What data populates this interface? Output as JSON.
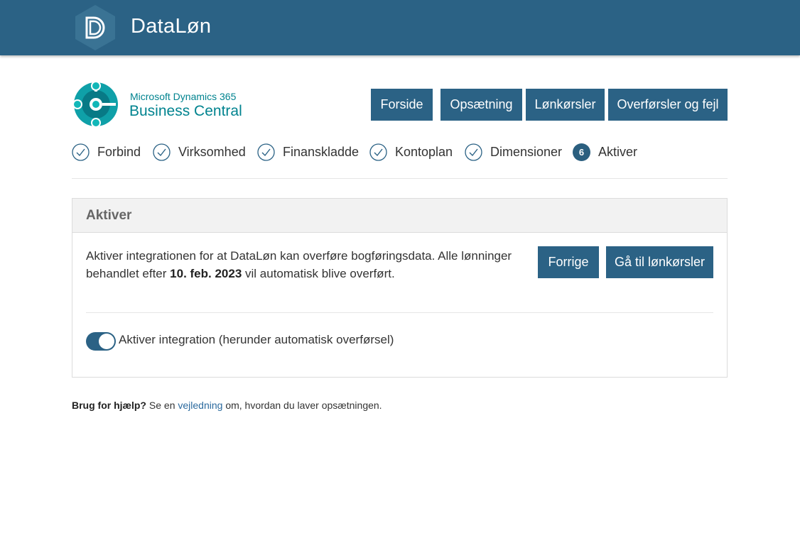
{
  "header": {
    "brand": "DataLøn"
  },
  "bc": {
    "line1": "Microsoft Dynamics 365",
    "line2": "Business Central"
  },
  "nav": [
    "Forside",
    "Opsætning",
    "Lønkørsler",
    "Overførsler og fejl"
  ],
  "steps": [
    {
      "label": "Forbind",
      "state": "done"
    },
    {
      "label": "Virksomhed",
      "state": "done"
    },
    {
      "label": "Finanskladde",
      "state": "done"
    },
    {
      "label": "Kontoplan",
      "state": "done"
    },
    {
      "label": "Dimensioner",
      "state": "done"
    },
    {
      "label": "Aktiver",
      "state": "current",
      "number": "6"
    }
  ],
  "panel": {
    "title": "Aktiver",
    "desc_before": "Aktiver integrationen for at DataLøn kan overføre bogføringsdata. Alle lønninger behandlet efter ",
    "desc_date": "10. feb. 2023",
    "desc_after": " vil automatisk blive overført.",
    "prev_button": "Forrige",
    "next_button": "Gå til lønkørsler",
    "toggle_label": "Aktiver integration (herunder automatisk overførsel)",
    "toggle_on": true
  },
  "help": {
    "bold": "Brug for hjælp?",
    "before": " Se en ",
    "link": "vejledning",
    "after": " om, hvordan du laver opsætningen."
  },
  "colors": {
    "primary": "#2b6285",
    "teal": "#00838f"
  }
}
